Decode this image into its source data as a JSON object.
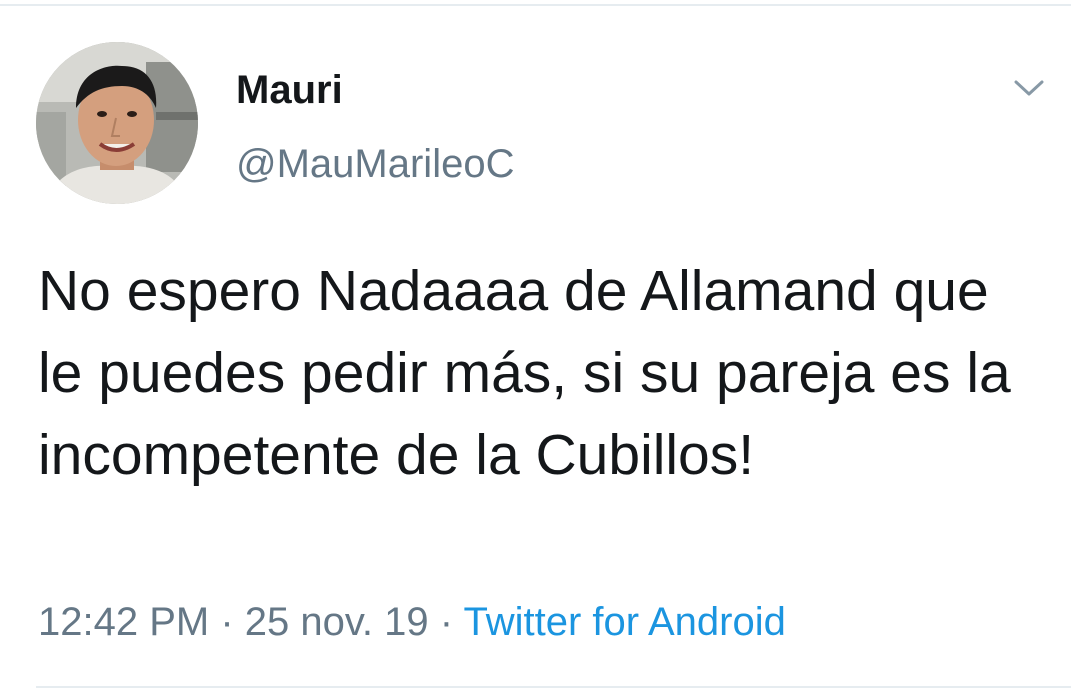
{
  "tweet": {
    "author": {
      "display_name": "Mauri",
      "handle": "@MauMarileoC",
      "avatar_icon": "profile-photo"
    },
    "menu_icon": "chevron-down-icon",
    "text": "No espero Nadaaaa de Allamand que le puedes pedir más, si su pareja es la incompetente de la Cubillos!",
    "time": "12:42 PM",
    "date": "25 nov. 19",
    "separator": "·",
    "source": "Twitter for Android"
  },
  "colors": {
    "text": "#14171a",
    "secondary": "#657786",
    "link": "#1b95e0",
    "divider": "#e6ecf0",
    "chevron": "#8899a6"
  }
}
